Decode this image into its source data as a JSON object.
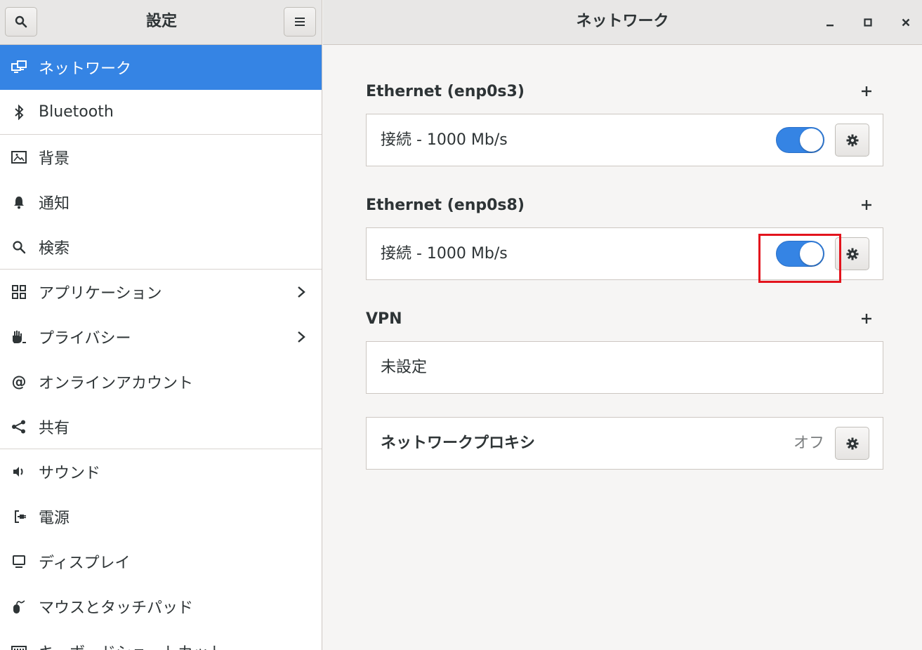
{
  "header": {
    "app_title": "設定",
    "page_title": "ネットワーク"
  },
  "sidebar": {
    "items": [
      {
        "label": "ネットワーク"
      },
      {
        "label": "Bluetooth"
      },
      {
        "label": "背景"
      },
      {
        "label": "通知"
      },
      {
        "label": "検索"
      },
      {
        "label": "アプリケーション"
      },
      {
        "label": "プライバシー"
      },
      {
        "label": "オンラインアカウント"
      },
      {
        "label": "共有"
      },
      {
        "label": "サウンド"
      },
      {
        "label": "電源"
      },
      {
        "label": "ディスプレイ"
      },
      {
        "label": "マウスとタッチパッド"
      },
      {
        "label": "キーボードショートカット"
      }
    ]
  },
  "main": {
    "eth1": {
      "title": "Ethernet (enp0s3)",
      "status": "接続 - 1000 Mb/s",
      "enabled": true
    },
    "eth2": {
      "title": "Ethernet (enp0s8)",
      "status": "接続 - 1000 Mb/s",
      "enabled": true
    },
    "vpn": {
      "title": "VPN",
      "status": "未設定"
    },
    "proxy": {
      "title": "ネットワークプロキシ",
      "status": "オフ"
    }
  },
  "colors": {
    "accent": "#3584e4",
    "highlight": "#e3141d"
  }
}
